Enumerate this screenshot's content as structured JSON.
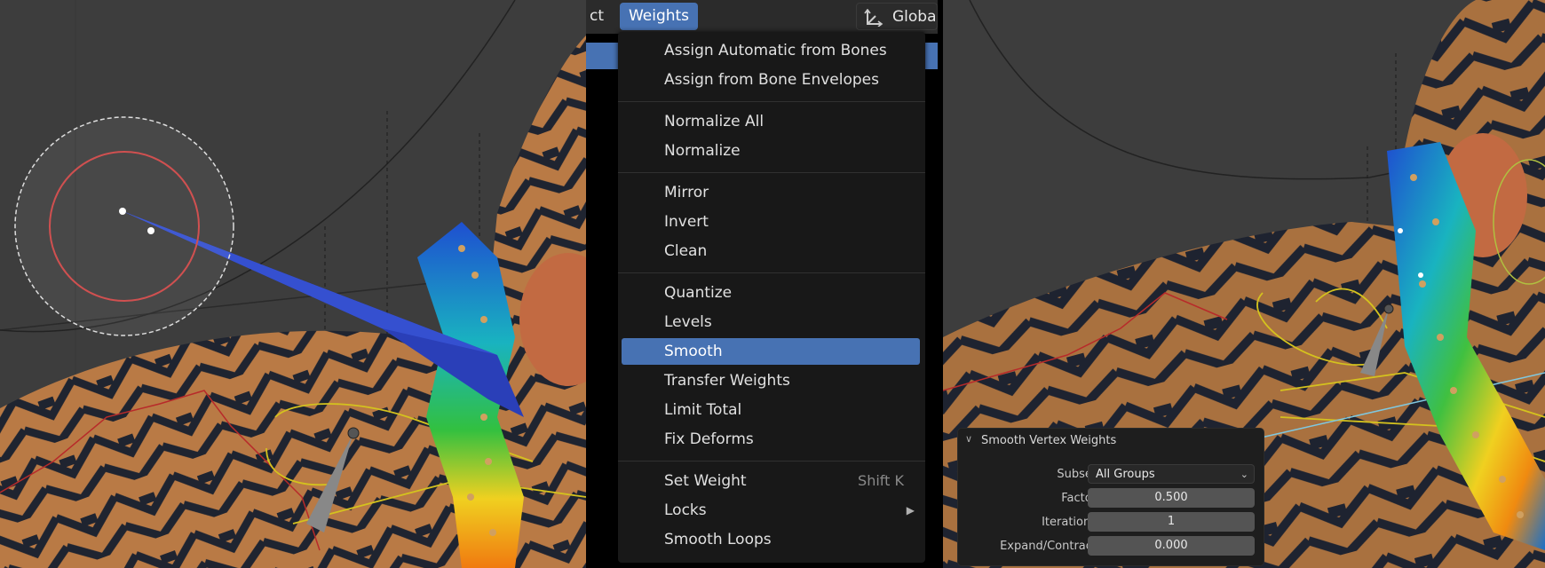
{
  "header": {
    "prev_menu_partial": "ct",
    "weights_menu": "Weights",
    "orientation_label": "Global"
  },
  "menu": {
    "items": [
      {
        "label": "Assign Automatic from Bones"
      },
      {
        "label": "Assign from Bone Envelopes"
      },
      {
        "label": "Normalize All"
      },
      {
        "label": "Normalize"
      },
      {
        "label": "Mirror"
      },
      {
        "label": "Invert"
      },
      {
        "label": "Clean"
      },
      {
        "label": "Quantize"
      },
      {
        "label": "Levels"
      },
      {
        "label": "Smooth",
        "active": true
      },
      {
        "label": "Transfer Weights"
      },
      {
        "label": "Limit Total"
      },
      {
        "label": "Fix Deforms"
      },
      {
        "label": "Set Weight",
        "shortcut": "Shift K"
      },
      {
        "label": "Locks",
        "submenu": true
      },
      {
        "label": "Smooth Loops"
      }
    ]
  },
  "operator_panel": {
    "title": "Smooth Vertex Weights",
    "subset_label": "Subset",
    "subset_value": "All Groups",
    "factor_label": "Factor",
    "factor_value": "0.500",
    "iterations_label": "Iterations",
    "iterations_value": "1",
    "expand_label": "Expand/Contract",
    "expand_value": "0.000"
  },
  "colors": {
    "accent": "#4772b3",
    "viewport_bg": "#3d3d3d",
    "menu_bg": "#181818"
  },
  "icons": [
    "transform-orientation-icon",
    "chevron-down-icon",
    "submenu-arrow-icon",
    "brush-cursor-icon"
  ]
}
